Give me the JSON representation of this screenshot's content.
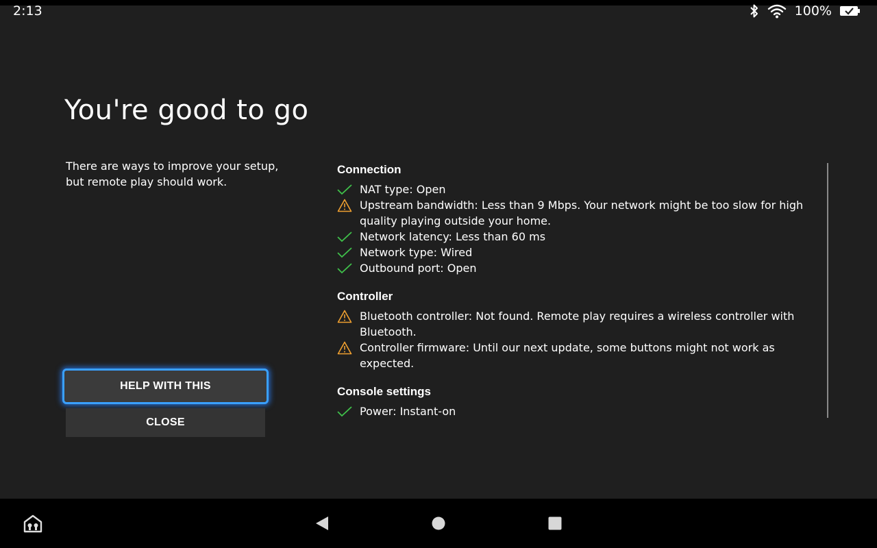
{
  "status_bar": {
    "time": "2:13",
    "battery": "100%",
    "icons": [
      "bluetooth-icon",
      "wifi-icon",
      "battery-icon"
    ]
  },
  "title": "You're good to go",
  "description": "There are ways to improve your setup, but remote play should work.",
  "buttons": {
    "help": "HELP WITH THIS",
    "close": "CLOSE"
  },
  "colors": {
    "background": "#1f1f1f",
    "ok": "#3fbf4a",
    "warning": "#f0a030",
    "focus": "#3aa0ff"
  },
  "sections": [
    {
      "title": "Connection",
      "items": [
        {
          "status": "ok",
          "text": "NAT type: Open"
        },
        {
          "status": "warning",
          "text": "Upstream bandwidth: Less than 9 Mbps. Your network might be too slow for high quality playing outside your home."
        },
        {
          "status": "ok",
          "text": "Network latency: Less than 60 ms"
        },
        {
          "status": "ok",
          "text": "Network type: Wired"
        },
        {
          "status": "ok",
          "text": "Outbound port: Open"
        }
      ]
    },
    {
      "title": "Controller",
      "items": [
        {
          "status": "warning",
          "text": "Bluetooth controller: Not found. Remote play requires a wireless controller with Bluetooth."
        },
        {
          "status": "warning",
          "text": "Controller firmware: Until our next update, some buttons might not work as expected."
        }
      ]
    },
    {
      "title": "Console settings",
      "items": [
        {
          "status": "ok",
          "text": "Power: Instant-on"
        }
      ]
    }
  ],
  "nav_bar": {
    "icons": [
      "app-switch-icon",
      "back-icon",
      "home-icon",
      "recents-icon"
    ]
  }
}
